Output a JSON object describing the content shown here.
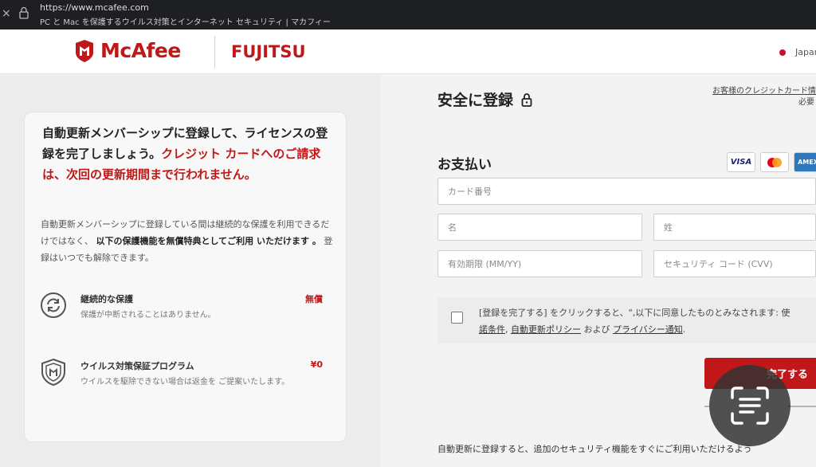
{
  "browser": {
    "url": "https://www.mcafee.com",
    "page_title": "PC と Mac を保護するウイルス対策とインターネット セキュリティ | マカフィー",
    "close_label": "×"
  },
  "header": {
    "brand": "McAfee",
    "partner": "FUJITSU",
    "language": "Japan"
  },
  "promo": {
    "heading_black": "自動更新メンバーシップに登録して、ライセンスの登録を完了しましょう。",
    "heading_red": "クレジット カードへのご請求は、次回の更新期間まで行われません。",
    "desc_part1": "自動更新メンバーシップに登録している間は継続的な保護を利用できるだけではなく、",
    "desc_bold": "以下の保護機能を無償特典としてご利用 いただけます 。",
    "desc_part2": "登録はいつでも解除できます。",
    "benefits": [
      {
        "title": "継続的な保護",
        "subtitle": "保護が中断されることはありません。",
        "value": "無償",
        "icon": "sync-icon"
      },
      {
        "title": "ウイルス対策保証プログラム",
        "subtitle": "ウイルスを駆除できない場合は返金を ご提案いたします。",
        "value": "¥0",
        "icon": "shield-icon"
      }
    ]
  },
  "form": {
    "title": "安全に登録",
    "cc_link_line1": "お客様のクレジットカード情",
    "cc_link_line2": "必要",
    "payment_title": "お支払い",
    "card_brands": [
      "VISA",
      "MC",
      "AMEX"
    ],
    "card_number_placeholder": "カード番号",
    "first_name_placeholder": "名",
    "last_name_placeholder": "姓",
    "expiry_placeholder": "有効期限 (MM/YY)",
    "cvv_placeholder": "セキュリティ コード (CVV)",
    "terms_line1": "[登録を完了する] をクリックすると、\",以下に同意したものとみなされます: 使",
    "terms_link1": "諾条件",
    "terms_link2": "自動更新ポリシー",
    "terms_and": " および ",
    "terms_link3": "プライバシー通知",
    "terms_end": ".",
    "complete_button": "完了する",
    "bottom_text": "自動更新に登録すると、追加のセキュリティ機能をすぐにご利用いただけるよう"
  }
}
